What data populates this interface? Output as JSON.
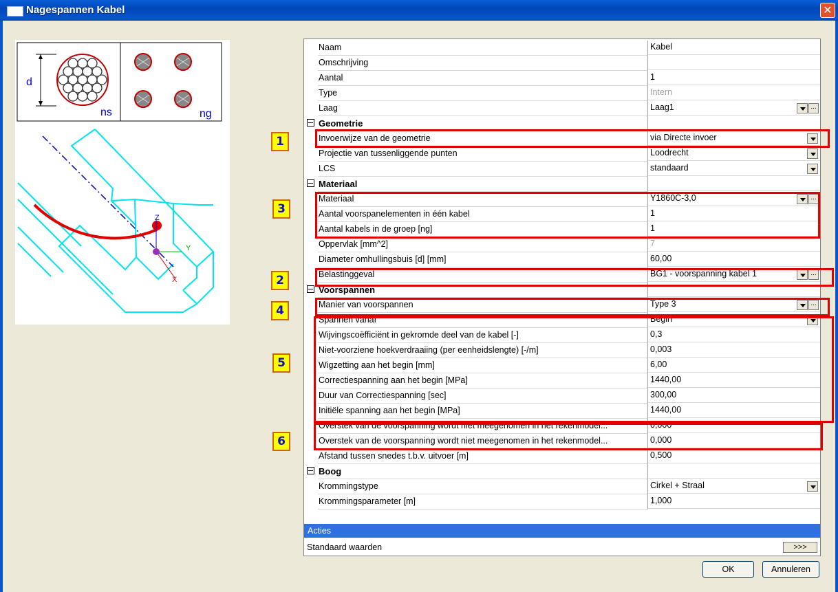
{
  "window": {
    "title": "Nagespannen Kabel",
    "close_glyph": "✕"
  },
  "diagram": {
    "label_d": "d",
    "label_ns": "ns",
    "label_ng": "ng",
    "axis_z": "Z",
    "axis_y": "Y",
    "axis_x": "X"
  },
  "rows": [
    {
      "type": "prop",
      "label": "Naam",
      "value": "Kabel"
    },
    {
      "type": "prop",
      "label": "Omschrijving",
      "value": ""
    },
    {
      "type": "prop",
      "label": "Aantal",
      "value": "1"
    },
    {
      "type": "prop",
      "label": "Type",
      "value": "Intern",
      "gray": true
    },
    {
      "type": "prop",
      "label": "Laag",
      "value": "Laag1",
      "dropdown": true,
      "ellipsis": true
    },
    {
      "type": "cat",
      "label": "Geometrie"
    },
    {
      "type": "prop",
      "label": "Invoerwijze van de geometrie",
      "value": "via Directe invoer",
      "dropdown": true
    },
    {
      "type": "prop",
      "label": "Projectie van tussenliggende punten",
      "value": "Loodrecht",
      "dropdown": true
    },
    {
      "type": "prop",
      "label": "LCS",
      "value": "standaard",
      "dropdown": true
    },
    {
      "type": "cat",
      "label": "Materiaal"
    },
    {
      "type": "prop",
      "label": "Materiaal",
      "value": "Y1860C-3,0",
      "dropdown": true,
      "ellipsis": true
    },
    {
      "type": "prop",
      "label": "Aantal voorspanelementen in één kabel",
      "value": "1"
    },
    {
      "type": "prop",
      "label": "Aantal kabels in de groep [ng]",
      "value": "1"
    },
    {
      "type": "prop",
      "label": "Oppervlak [mm^2]",
      "value": "7",
      "gray": true
    },
    {
      "type": "prop",
      "label": "Diameter omhullingsbuis [d] [mm]",
      "value": "60,00"
    },
    {
      "type": "prop",
      "label": "Belastinggeval",
      "value": "BG1 - voorspanning kabel 1",
      "dropdown": true,
      "ellipsis": true
    },
    {
      "type": "cat",
      "label": "Voorspannen"
    },
    {
      "type": "prop",
      "label": "Manier van voorspannen",
      "value": "Type 3",
      "dropdown": true,
      "ellipsis": true
    },
    {
      "type": "prop",
      "label": "Spannen vanaf",
      "value": "Begin",
      "dropdown": true
    },
    {
      "type": "prop",
      "label": "Wijvingscoëfficiënt in gekromde deel van de kabel [-]",
      "value": "0,3"
    },
    {
      "type": "prop",
      "label": "Niet-voorziene hoekverdraaiing (per eenheidslengte) [-/m]",
      "value": "0,003"
    },
    {
      "type": "prop",
      "label": "Wigzetting aan het begin [mm]",
      "value": "6,00"
    },
    {
      "type": "prop",
      "label": "Correctiespanning aan het begin [MPa]",
      "value": "1440,00"
    },
    {
      "type": "prop",
      "label": "Duur van Correctiespanning [sec]",
      "value": "300,00"
    },
    {
      "type": "prop",
      "label": "Initiële spanning aan het begin [MPa]",
      "value": "1440,00"
    },
    {
      "type": "prop",
      "label": "Overstek van de voorspanning wordt niet meegenomen in het rekenmodel...",
      "value": "0,000"
    },
    {
      "type": "prop",
      "label": "Overstek van de voorspanning wordt niet meegenomen in het rekenmodel...",
      "value": "0,000"
    },
    {
      "type": "prop",
      "label": "Afstand tussen snedes t.b.v. uitvoer [m]",
      "value": "0,500"
    },
    {
      "type": "cat",
      "label": "Boog"
    },
    {
      "type": "prop",
      "label": "Krommingstype",
      "value": "Cirkel + Straal",
      "dropdown": true
    },
    {
      "type": "prop",
      "label": "Krommingsparameter [m]",
      "value": "1,000"
    }
  ],
  "actions": {
    "title": "Acties",
    "standard_label": "Standaard waarden",
    "standard_button": ">>>"
  },
  "buttons": {
    "ok": "OK",
    "cancel": "Annuleren"
  },
  "annotations": [
    "1",
    "3",
    "2",
    "4",
    "5",
    "6"
  ]
}
